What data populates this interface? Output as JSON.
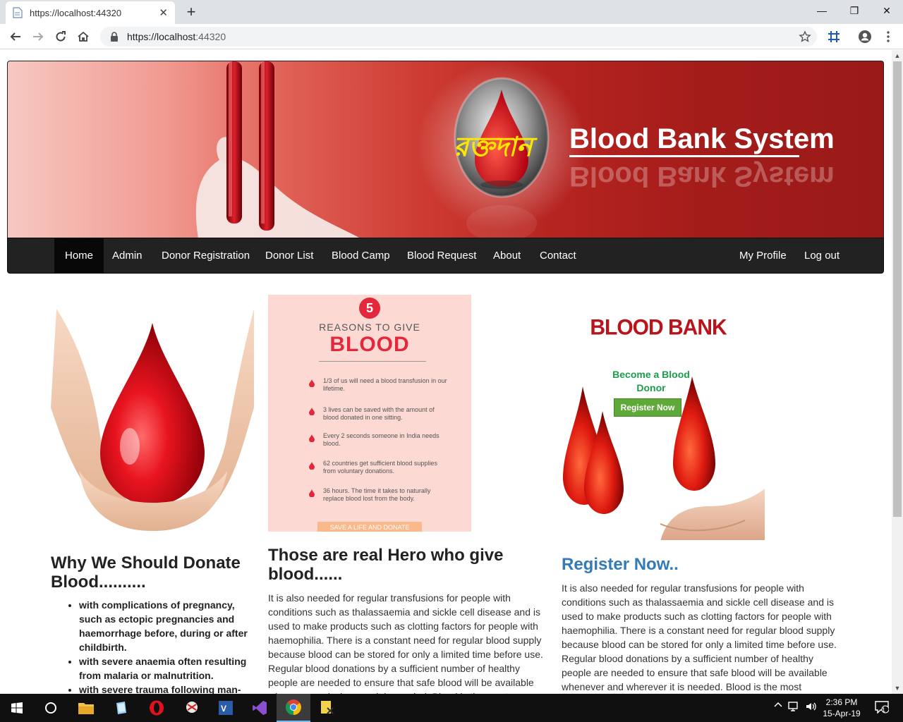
{
  "browser": {
    "tab_title": "https://localhost:44320",
    "url_host": "https://localhost",
    "url_port": ":44320"
  },
  "banner": {
    "title": "Blood Bank System",
    "bengali_text": "রক্তদান"
  },
  "nav": {
    "items": [
      "Home",
      "Admin",
      "Donor Registration",
      "Donor List",
      "Blood Camp",
      "Blood Request",
      "About",
      "Contact"
    ],
    "right": [
      "My Profile",
      "Log out"
    ],
    "active": "Home"
  },
  "infographic": {
    "number": "5",
    "subtitle": "REASONS TO GIVE",
    "title": "BLOOD",
    "reasons": [
      "1/3 of us will need a blood transfusion in our lifetime.",
      "3 lives can be saved with the amount of blood donated in one sitting.",
      "Every 2 seconds someone in India needs blood.",
      "62 countries get sufficient blood supplies from voluntary donations.",
      "36 hours. The time it takes to naturally replace blood lost from the body."
    ],
    "footer": "SAVE A LIFE AND DONATE"
  },
  "promo": {
    "title": "BLOOD BANK",
    "tagline_line1": "Become a Blood",
    "tagline_line2": "Donor",
    "button": "Register Now"
  },
  "col1": {
    "heading": "Why We Should Donate Blood..........",
    "bullets": [
      "with complications of pregnancy, such as ectopic pregnancies and haemorrhage before, during or after childbirth.",
      "with severe anaemia often resulting from malaria or malnutrition.",
      "with severe trauma following man-"
    ]
  },
  "col2": {
    "heading": "Those are real Hero who give blood......",
    "text": "It is also needed for regular transfusions for people with conditions such as thalassaemia and sickle cell disease and is used to make products such as clotting factors for people with haemophilia. There is a constant need for regular blood supply because blood can be stored for only a limited time before use. Regular blood donations by a sufficient number of healthy people are needed to ensure that safe blood will be available whenever and wherever it is needed. Blood is the most"
  },
  "col3": {
    "heading": "Register Now..",
    "text": "It is also needed for regular transfusions for people with conditions such as thalassaemia and sickle cell disease and is used to make products such as clotting factors for people with haemophilia. There is a constant need for regular blood supply because blood can be stored for only a limited time before use. Regular blood donations by a sufficient number of healthy people are needed to ensure that safe blood will be available whenever and wherever it is needed. Blood is the most"
  },
  "taskbar": {
    "time": "2:36 PM",
    "date": "15-Apr-19",
    "notification_count": "1"
  },
  "colors": {
    "navbar_bg": "#222222",
    "heading_blue": "#337ab7",
    "register_green": "#5fa83a",
    "blood_red": "#d0021b"
  }
}
